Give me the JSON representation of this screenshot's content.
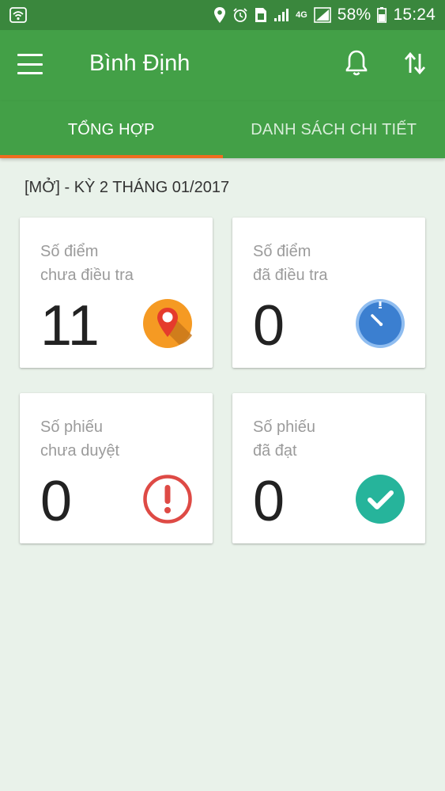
{
  "status_bar": {
    "battery_percent": "58%",
    "time": "15:24",
    "network_label": "4G"
  },
  "app_bar": {
    "title": "Bình Định"
  },
  "tabs": [
    {
      "label": "TỔNG HỢP",
      "active": true
    },
    {
      "label": "DANH SÁCH CHI TIẾT",
      "active": false
    }
  ],
  "period_label": "[MỞ] - KỲ 2 THÁNG 01/2017",
  "cards": [
    {
      "line1": "Số điểm",
      "line2": "chưa điều tra",
      "count": "11",
      "icon": "map-pin-icon",
      "icon_color": "#f59a23"
    },
    {
      "line1": "Số điểm",
      "line2": "đã điều tra",
      "count": "0",
      "icon": "stopwatch-icon",
      "icon_color": "#3b7fd0"
    },
    {
      "line1": "Số phiếu",
      "line2": "chưa duyệt",
      "count": "0",
      "icon": "alert-icon",
      "icon_color": "#de4a45"
    },
    {
      "line1": "Số phiếu",
      "line2": "đã đạt",
      "count": "0",
      "icon": "check-icon",
      "icon_color": "#26b49b"
    }
  ],
  "colors": {
    "status_bar": "#3a873d",
    "primary": "#43a047",
    "tab_indicator": "#ef6c1f",
    "background": "#e9f2ea"
  }
}
